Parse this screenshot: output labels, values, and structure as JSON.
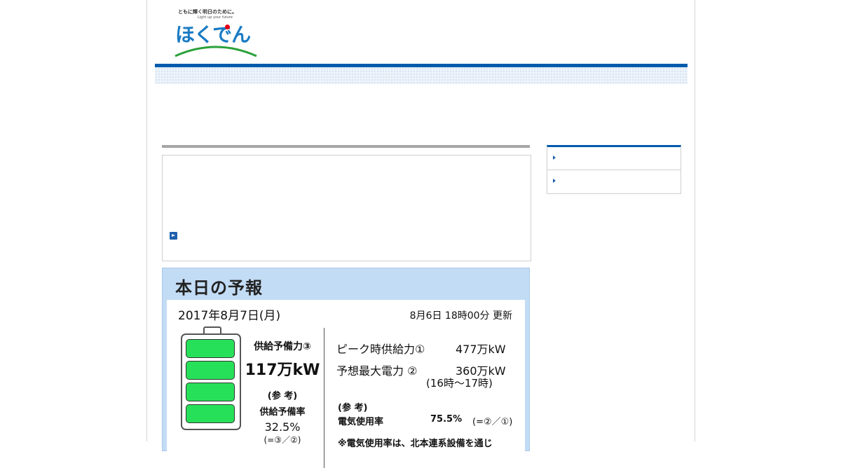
{
  "header": {
    "tagline": "ともに輝く明日のために。",
    "tagline_en": "Light up your future",
    "logo_text": "ほくでん"
  },
  "colors": {
    "brand_blue": "#005bac",
    "logo_blue": "#1a7bc4",
    "battery_green": "#27e05a",
    "panel_blue": "#c3dcf5"
  },
  "forecast": {
    "title": "本日の予報",
    "date": "2017年8月7日(月)",
    "updated": "8月6日 18時00分 更新",
    "reserve_label": "供給予備力③",
    "reserve_value": "117万kW",
    "ref_label": "(参 考)",
    "reserve_rate_label": "供給予備率",
    "reserve_rate": "32.5%",
    "reserve_rate_formula": "(=③／②)",
    "peak_supply_label": "ピーク時供給力①",
    "peak_supply_value": "477万kW",
    "max_demand_label": "予想最大電力 ②",
    "max_demand_value": "360万kW",
    "max_demand_time": "(16時～17時)",
    "ref_label2": "(参 考)",
    "usage_label": "電気使用率",
    "usage_value": "75.5%",
    "usage_formula": "(=②／①)",
    "cut_text": "※電気使用率は、北本連系設備を通じ"
  },
  "battery": {
    "filled_cells": 4,
    "total_cells": 4
  },
  "icons": {
    "notice_link": "arrow-right-icon",
    "side_bullet": "triangle-right-icon"
  }
}
